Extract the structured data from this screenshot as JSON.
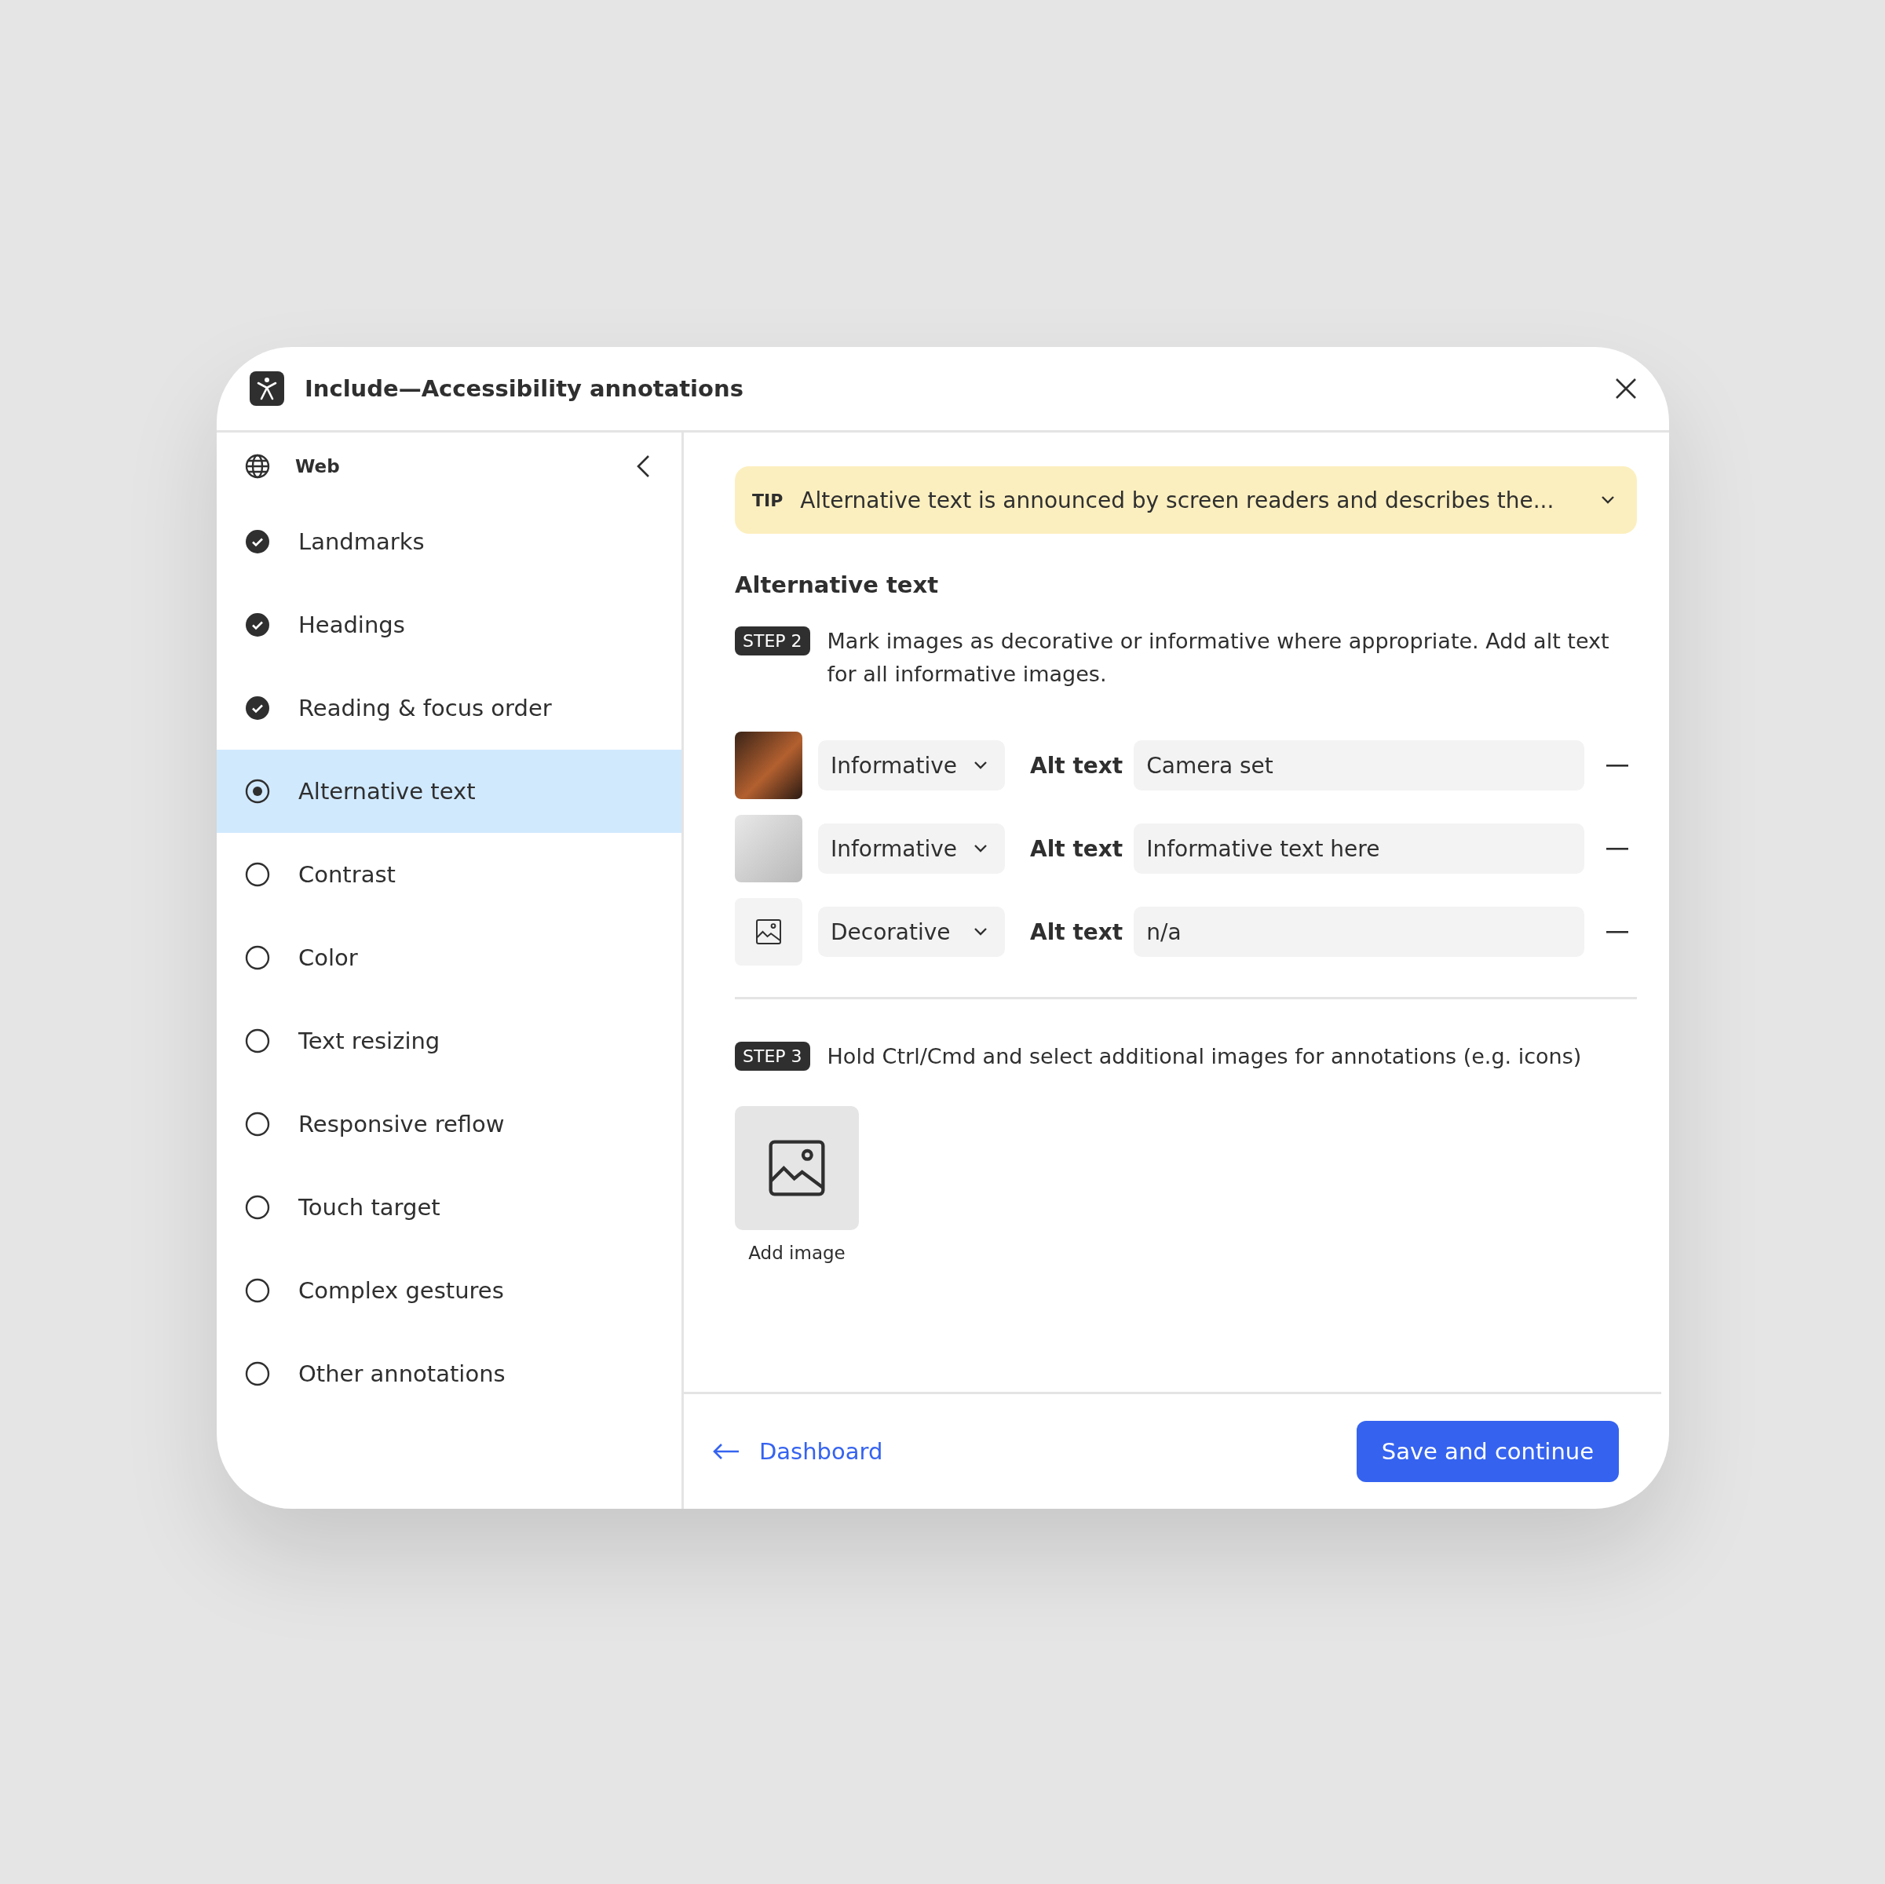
{
  "window": {
    "title": "Include—Accessibility annotations"
  },
  "sidebar": {
    "platform": "Web",
    "items": [
      {
        "label": "Landmarks",
        "checked": true,
        "selected": false
      },
      {
        "label": "Headings",
        "checked": true,
        "selected": false
      },
      {
        "label": "Reading & focus order",
        "checked": true,
        "selected": false
      },
      {
        "label": "Alternative text",
        "checked": false,
        "selected": true
      },
      {
        "label": "Contrast",
        "checked": false,
        "selected": false
      },
      {
        "label": "Color",
        "checked": false,
        "selected": false
      },
      {
        "label": "Text resizing",
        "checked": false,
        "selected": false
      },
      {
        "label": "Responsive reflow",
        "checked": false,
        "selected": false
      },
      {
        "label": "Touch target",
        "checked": false,
        "selected": false
      },
      {
        "label": "Complex gestures",
        "checked": false,
        "selected": false
      },
      {
        "label": "Other annotations",
        "checked": false,
        "selected": false
      }
    ]
  },
  "tip": {
    "badge": "TIP",
    "text": "Alternative text is announced by screen readers and describes the..."
  },
  "section_title": "Alternative text",
  "step2": {
    "badge": "STEP 2",
    "text": "Mark images as decorative or informative where appropriate. Add alt text for all informative images."
  },
  "images": [
    {
      "kind": "dark-photo",
      "type": "Informative",
      "label": "Alt text",
      "value": "Camera set"
    },
    {
      "kind": "light-photo",
      "type": "Informative",
      "label": "Alt text",
      "value": "Informative text here"
    },
    {
      "kind": "placeholder",
      "type": "Decorative",
      "label": "Alt text",
      "value": "n/a"
    }
  ],
  "step3": {
    "badge": "STEP 3",
    "text": "Hold Ctrl/Cmd and select additional images for annotations (e.g. icons)"
  },
  "add_image": {
    "label": "Add image"
  },
  "footer": {
    "back_link": "Dashboard",
    "primary_button": "Save and continue"
  }
}
